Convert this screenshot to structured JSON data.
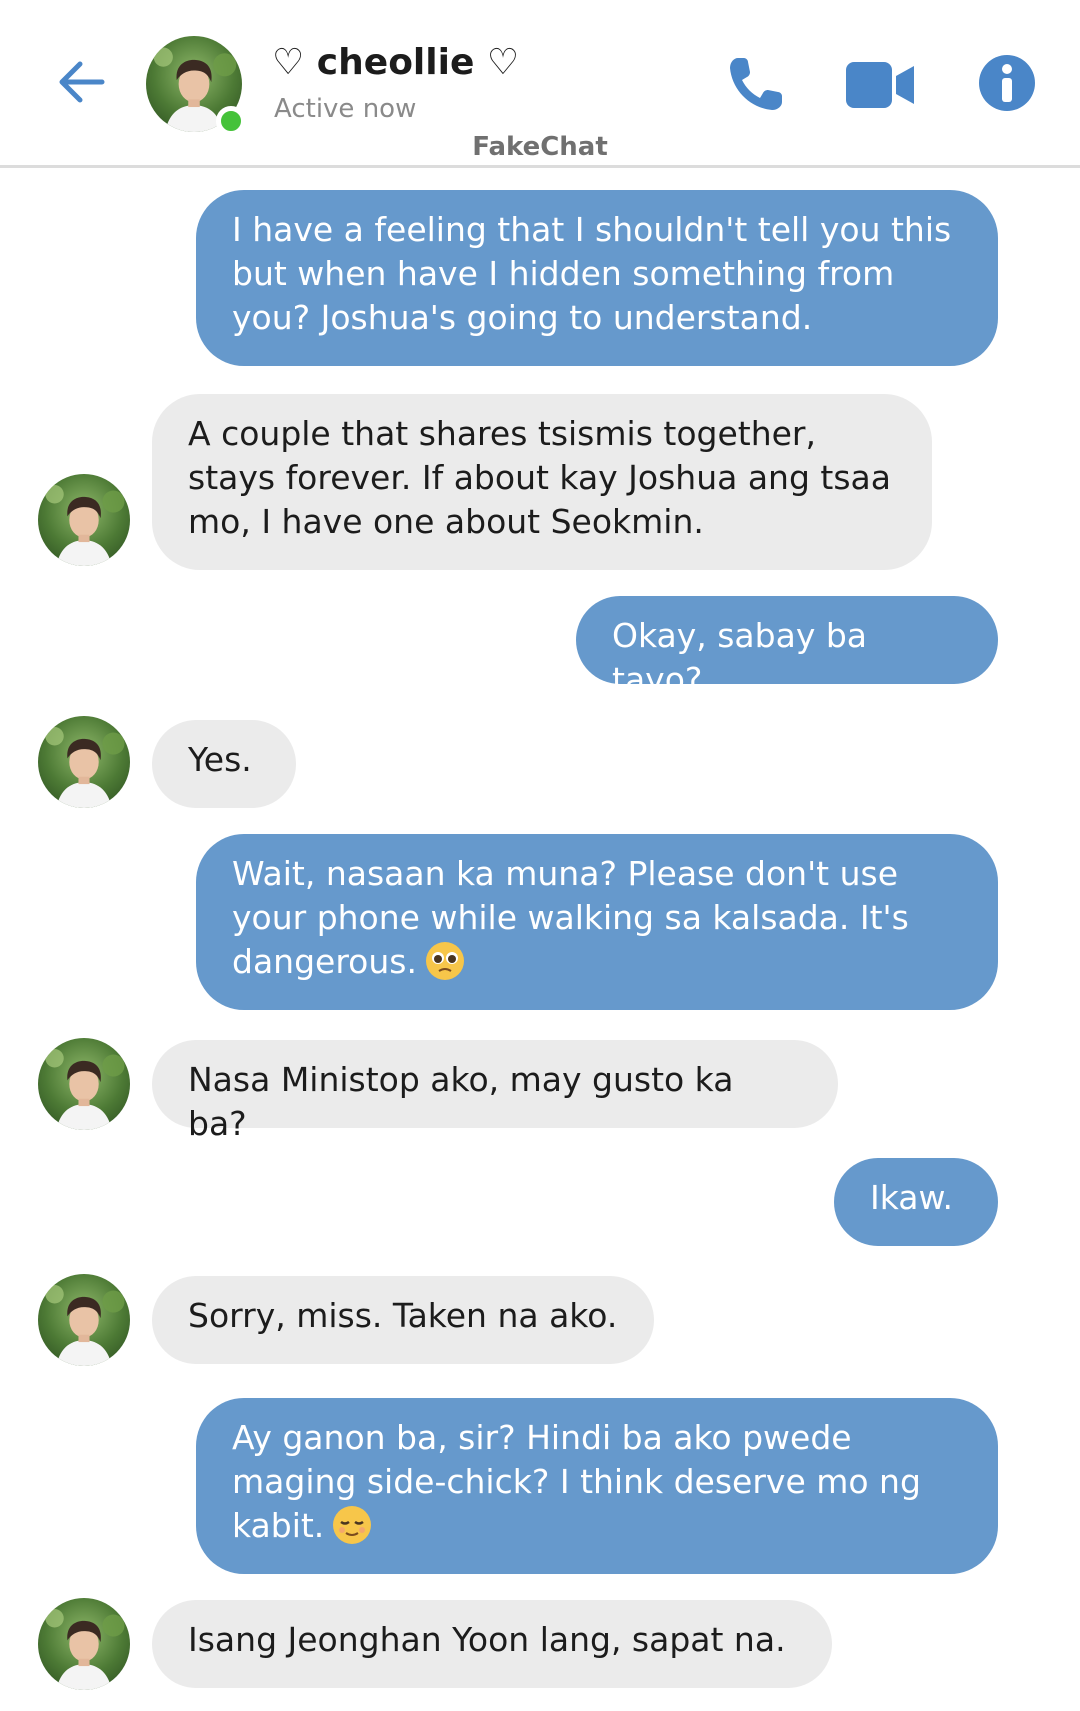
{
  "header": {
    "contact_name": "♡ cheollie ♡",
    "status": "Active now",
    "app_label": "FakeChat",
    "icons": [
      "back-arrow-icon",
      "phone-icon",
      "video-camera-icon",
      "info-icon"
    ]
  },
  "colors": {
    "outgoing_bubble": "#6699cc",
    "incoming_bubble": "#ebebeb",
    "accent": "#4a86c8",
    "online": "#45c23a"
  },
  "messages": [
    {
      "sender": "me",
      "text": "I have a feeling that I shouldn't tell you this but when have I hidden something from you? Joshua's going to understand."
    },
    {
      "sender": "them",
      "text": "A couple that shares tsismis together, stays forever. If about kay Joshua ang tsaa mo, I have one about Seokmin."
    },
    {
      "sender": "me",
      "text": "Okay, sabay ba tayo?"
    },
    {
      "sender": "them",
      "text": "Yes."
    },
    {
      "sender": "me",
      "text": "Wait, nasaan ka muna? Please don't use your phone while walking sa kalsada. It's dangerous.",
      "emoji": "pleading-face-emoji"
    },
    {
      "sender": "them",
      "text": "Nasa Ministop ako, may gusto ka ba?"
    },
    {
      "sender": "me",
      "text": "Ikaw."
    },
    {
      "sender": "them",
      "text": "Sorry, miss. Taken na ako."
    },
    {
      "sender": "me",
      "text": "Ay ganon ba, sir? Hindi ba ako pwede maging side-chick? I think deserve mo ng kabit.",
      "emoji": "relieved-face-emoji"
    },
    {
      "sender": "them",
      "text": "Isang Jeonghan Yoon lang, sapat na."
    }
  ]
}
